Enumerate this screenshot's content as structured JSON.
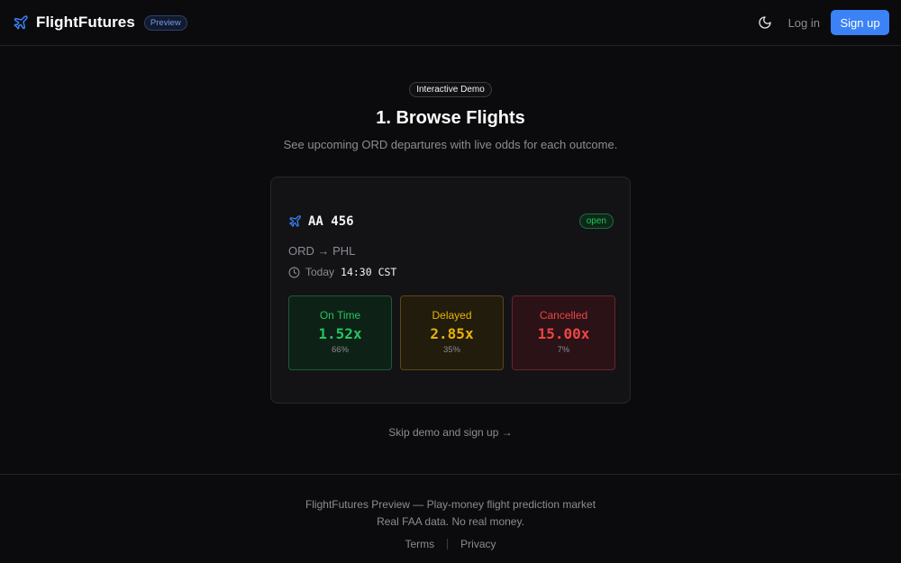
{
  "header": {
    "brand": "FlightFutures",
    "badge": "Preview",
    "login_label": "Log in",
    "signup_label": "Sign up"
  },
  "hero": {
    "pill": "Interactive Demo",
    "title": "1. Browse Flights",
    "subtitle": "See upcoming ORD departures with live odds for each outcome."
  },
  "flight": {
    "number": "AA 456",
    "status": "open",
    "route": "ORD → PHL",
    "day": "Today",
    "time": "14:30 CST",
    "outcomes": [
      {
        "label": "On Time",
        "odds": "1.52x",
        "pct": "66%"
      },
      {
        "label": "Delayed",
        "odds": "2.85x",
        "pct": "35%"
      },
      {
        "label": "Cancelled",
        "odds": "15.00x",
        "pct": "7%"
      }
    ]
  },
  "skip_label": "Skip demo and sign up →",
  "footer": {
    "line1": "FlightFutures Preview — Play-money flight prediction market",
    "line2": "Real FAA data. No real money.",
    "terms": "Terms",
    "privacy": "Privacy"
  },
  "colors": {
    "accent": "#3b82f6",
    "on_time": "#22c55e",
    "delayed": "#eab308",
    "cancelled": "#ef4444"
  },
  "icons": {
    "brand": "plane-icon",
    "theme": "moon-icon",
    "flight": "plane-icon",
    "time": "clock-icon"
  }
}
